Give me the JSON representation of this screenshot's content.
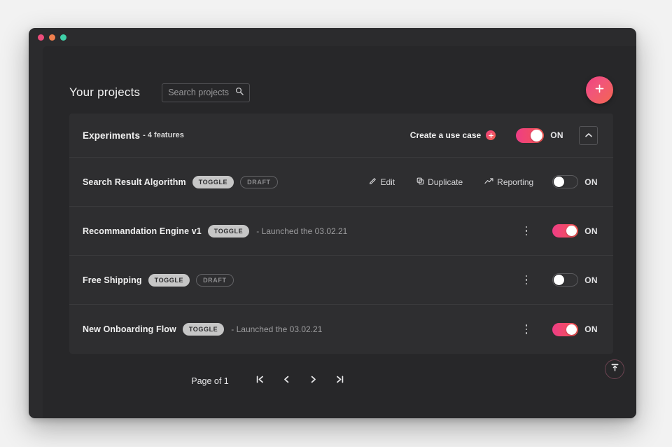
{
  "window": {
    "traffic_lights": [
      "close",
      "minimize",
      "zoom"
    ]
  },
  "header": {
    "title": "Your projects",
    "search": {
      "placeholder": "Search projects",
      "value": "",
      "icon": "search-icon"
    },
    "add_button": {
      "icon": "plus-icon",
      "label": "+"
    }
  },
  "project": {
    "name": "Experiments",
    "meta": "- 4 features",
    "use_case_label": "Create a use case",
    "use_case_icon": "plus-circle-icon",
    "toggle": {
      "state": "on",
      "label": "ON"
    },
    "collapse_icon": "chevron-up-icon"
  },
  "features": [
    {
      "name": "Search Result Algorithm",
      "badges": [
        {
          "text": "TOGGLE",
          "style": "solid"
        },
        {
          "text": "DRAFT",
          "style": "ghost"
        }
      ],
      "launched": "",
      "actions": [
        {
          "label": "Edit",
          "icon": "pencil-icon"
        },
        {
          "label": "Duplicate",
          "icon": "copy-icon"
        },
        {
          "label": "Reporting",
          "icon": "trending-up-icon"
        }
      ],
      "toggle": {
        "state": "off",
        "label": "ON"
      }
    },
    {
      "name": "Recommandation Engine v1",
      "badges": [
        {
          "text": "TOGGLE",
          "style": "solid"
        }
      ],
      "launched": "- Launched the 03.02.21",
      "actions": [],
      "toggle": {
        "state": "on",
        "label": "ON"
      }
    },
    {
      "name": "Free Shipping",
      "badges": [
        {
          "text": "TOGGLE",
          "style": "solid"
        },
        {
          "text": "DRAFT",
          "style": "ghost"
        }
      ],
      "launched": "",
      "actions": [],
      "toggle": {
        "state": "off",
        "label": "ON"
      }
    },
    {
      "name": "New Onboarding Flow",
      "badges": [
        {
          "text": "TOGGLE",
          "style": "solid"
        }
      ],
      "launched": "- Launched the 03.02.21",
      "actions": [],
      "toggle": {
        "state": "on",
        "label": "ON"
      }
    }
  ],
  "footer": {
    "page_text": "Page of 1",
    "buttons": [
      {
        "name": "first-page",
        "glyph": "|<"
      },
      {
        "name": "prev-page",
        "glyph": "<"
      },
      {
        "name": "next-page",
        "glyph": ">"
      },
      {
        "name": "last-page",
        "glyph": ">|"
      }
    ],
    "back_to_top_icon": "arrow-to-top-icon"
  },
  "colors": {
    "accent_pink": "#ee3d86",
    "accent_orange": "#f4564f",
    "window_bg": "#2b2b2d",
    "app_bg": "#272729",
    "card_bg": "#2e2e30",
    "divider": "#3a3a3c",
    "text_primary": "#f0f0f0",
    "text_muted": "#9d9d9f"
  }
}
